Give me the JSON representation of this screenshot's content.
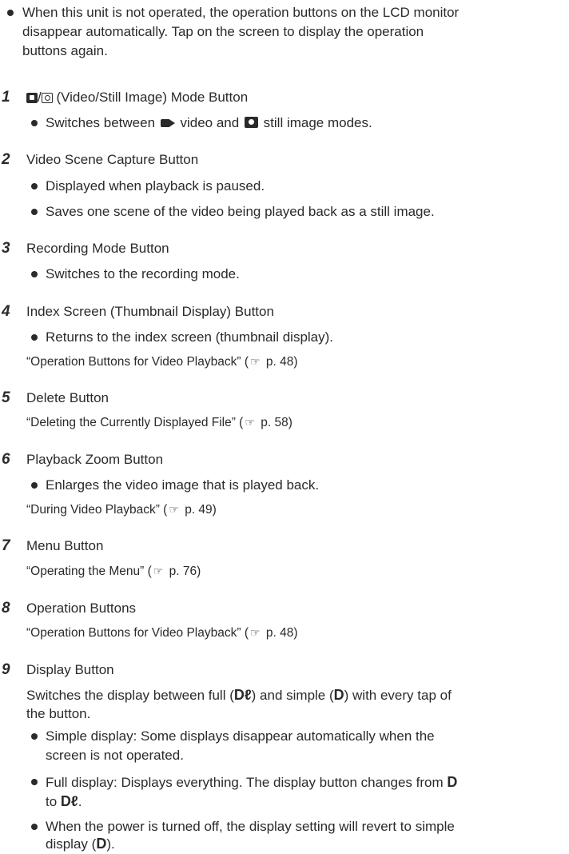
{
  "intro": {
    "lines": [
      "When this unit is not operated, the operation buttons on the LCD monitor",
      "disappear automatically. Tap on the screen to display the operation",
      "buttons again."
    ]
  },
  "ref_icon": "☞",
  "items": [
    {
      "number": "1",
      "title_suffix": " (Video/Still Image) Mode Button",
      "bullet": {
        "before": "Switches between",
        "middle": " video and ",
        "after": " still image modes."
      }
    },
    {
      "number": "2",
      "title": "Video Scene Capture Button",
      "bullets": [
        "Displayed when playback is paused.",
        "Saves one scene of the video being played back as a still image."
      ]
    },
    {
      "number": "3",
      "title": "Recording Mode Button",
      "bullets": [
        "Switches to the recording mode."
      ]
    },
    {
      "number": "4",
      "title": "Index Screen (Thumbnail Display) Button",
      "bullets": [
        "Returns to the index screen (thumbnail display)."
      ],
      "ref": {
        "text": "“Operation Buttons for Video Playback” (",
        "page": " p. 48)"
      }
    },
    {
      "number": "5",
      "title": "Delete Button",
      "ref": {
        "text": "“Deleting the Currently Displayed File” (",
        "page": " p. 58)"
      }
    },
    {
      "number": "6",
      "title": "Playback Zoom Button",
      "bullets": [
        "Enlarges the video image that is played back."
      ],
      "ref": {
        "text": "“During Video Playback” (",
        "page": " p. 49)"
      }
    },
    {
      "number": "7",
      "title": "Menu Button",
      "ref": {
        "text": "“Operating the Menu” (",
        "page": " p. 76)"
      }
    },
    {
      "number": "8",
      "title": "Operation Buttons",
      "ref": {
        "text": "“Operation Buttons for Video Playback” (",
        "page": " p. 48)"
      }
    },
    {
      "number": "9",
      "title": "Display Button",
      "para": {
        "line1_a": "Switches the display between full (",
        "d_full": "Dℓ",
        "line1_b": ") and simple (",
        "d_simple": "D",
        "line1_c": ") with every tap of",
        "line2": "the button."
      },
      "b1": {
        "line1": "Simple display: Some displays disappear automatically when the",
        "line2": "screen is not operated."
      },
      "b2": {
        "line1_a": "Full display: Displays everything. The display button changes from ",
        "d_simple": "D",
        "line2_a": "to ",
        "d_full": "Dℓ",
        "line2_b": "."
      },
      "b3": {
        "line1": "When the power is turned off, the display setting will revert to simple",
        "line2_a": "display (",
        "d_simple": "D",
        "line2_b": ")."
      }
    }
  ]
}
